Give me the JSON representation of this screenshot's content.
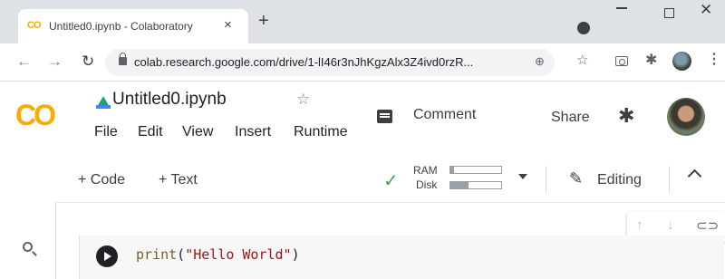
{
  "browser": {
    "tab": {
      "title": "Untitled0.ipynb - Colaboratory",
      "favicon": "CO",
      "close_label": "×"
    },
    "newtab_label": "+",
    "window_controls": {
      "close_label": "✕"
    },
    "nav": {
      "back": "←",
      "forward": "→",
      "reload": "↻"
    },
    "omnibox": {
      "url": "colab.research.google.com/drive/1-lI46r3nJhKgzAlx3Z4ivd0rzR...",
      "zoom_icon": "⊕"
    },
    "star": "☆",
    "extension_icon": "✱",
    "menu_icon": "⋮"
  },
  "colab": {
    "logo": "CO",
    "notebook_title": "Untitled0.ipynb",
    "title_star": "☆",
    "menus": [
      "File",
      "Edit",
      "View",
      "Insert",
      "Runtime"
    ],
    "comment_label": "Comment",
    "share_label": "Share",
    "settings_icon": "✱"
  },
  "toolbar": {
    "add_code": "+ Code",
    "add_text": "+ Text",
    "status_check": "✓",
    "ram_label": "RAM",
    "disk_label": "Disk",
    "ram_usage": 0.08,
    "disk_usage": 0.35,
    "edit_icon": "✎",
    "editing_label": "Editing"
  },
  "cell_toolbar": {
    "up": "↑",
    "down": "↓",
    "link": "⊂⊃"
  },
  "cell": {
    "code_fn": "print",
    "code_open": "(",
    "code_str": "\"Hello World\"",
    "code_close": ")"
  },
  "colors": {
    "brand": "#f9ab00",
    "status_ok": "#34a853",
    "drive_green": "#1fa463",
    "drive_blue": "#4285f4"
  }
}
